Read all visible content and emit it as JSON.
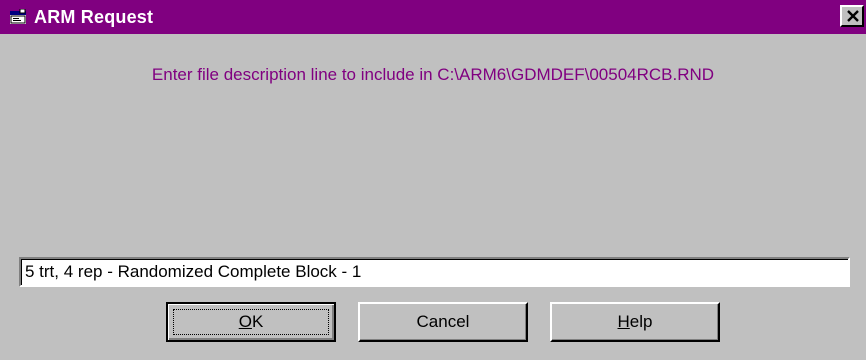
{
  "window": {
    "title": "ARM Request",
    "icon": "app-window-icon",
    "close_icon": "close-icon",
    "colors": {
      "titlebar": "#800080",
      "face": "#c0c0c0",
      "prompt_text": "#800080"
    }
  },
  "prompt": {
    "text": "Enter file description line to include in C:\\ARM6\\GDMDEF\\00504RCB.RND"
  },
  "description_field": {
    "value": "5 trt, 4 rep - Randomized Complete Block - 1"
  },
  "buttons": {
    "ok": {
      "mnemonic": "O",
      "rest": "K"
    },
    "cancel": {
      "label": "Cancel"
    },
    "help": {
      "mnemonic": "H",
      "rest": "elp"
    }
  }
}
